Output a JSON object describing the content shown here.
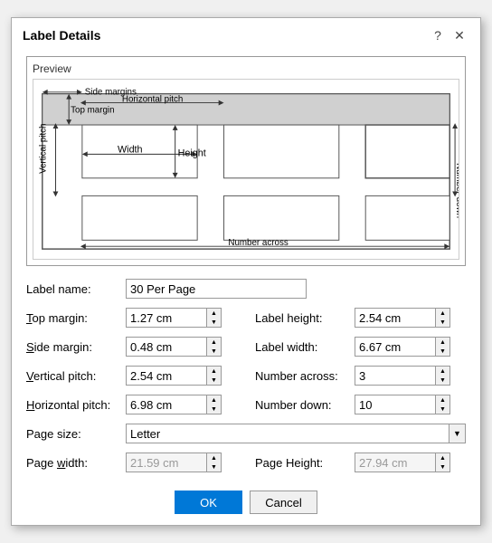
{
  "dialog": {
    "title": "Label Details",
    "help_btn": "?",
    "close_btn": "✕"
  },
  "preview": {
    "label": "Preview"
  },
  "form": {
    "label_name_label": "Label name:",
    "label_name_value": "30 Per Page",
    "top_margin_label": "Top margin:",
    "top_margin_value": "1.27 cm",
    "label_height_label": "Label height:",
    "label_height_value": "2.54 cm",
    "side_margin_label": "Side margin:",
    "side_margin_value": "0.48 cm",
    "label_width_label": "Label width:",
    "label_width_value": "6.67 cm",
    "vertical_pitch_label": "Vertical pitch:",
    "vertical_pitch_value": "2.54 cm",
    "number_across_label": "Number across:",
    "number_across_value": "3",
    "horizontal_pitch_label": "Horizontal pitch:",
    "horizontal_pitch_value": "6.98 cm",
    "number_down_label": "Number down:",
    "number_down_value": "10",
    "page_size_label": "Page size:",
    "page_size_value": "Letter",
    "page_width_label": "Page width:",
    "page_width_value": "21.59 cm",
    "page_height_label": "Page Height:",
    "page_height_value": "27.94 cm"
  },
  "buttons": {
    "ok_label": "OK",
    "cancel_label": "Cancel"
  },
  "diagram": {
    "labels": {
      "side_margins": "Side margins",
      "horizontal_pitch": "Horizontal pitch",
      "top_margin": "Top margin",
      "vertical_pitch": "Vertical pitch",
      "width": "Width",
      "height": "Height",
      "number_across": "Number across",
      "number_down": "Number down"
    }
  }
}
